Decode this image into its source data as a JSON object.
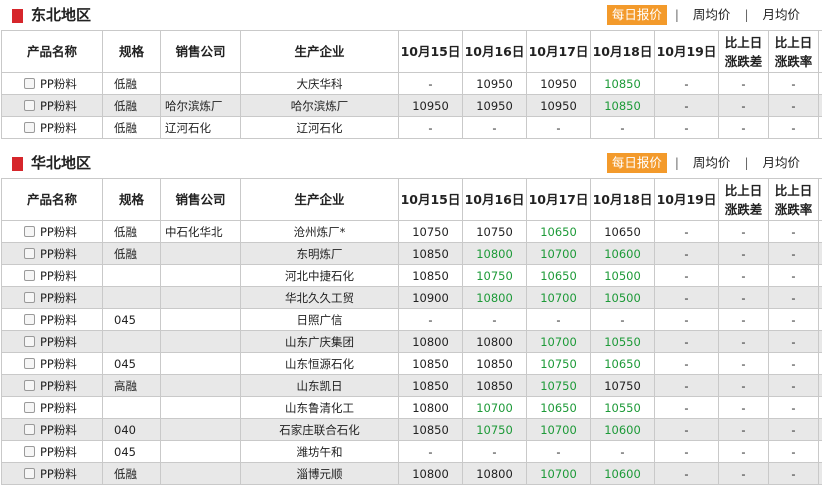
{
  "tabs": {
    "daily": "每日报价",
    "weekly": "周均价",
    "monthly": "月均价",
    "separator": "|"
  },
  "colors": {
    "accent": "#f39a2b",
    "marker": "#d6262b",
    "down": "#1d9a38",
    "row_alt": "#e8e8e8"
  },
  "columns": {
    "name": "产品名称",
    "spec": "规格",
    "sales": "销售公司",
    "producer": "生产企业",
    "d1": "10月15日",
    "d2": "10月16日",
    "d3": "10月17日",
    "d4": "10月18日",
    "d5": "10月19日",
    "diff_top": "比上日",
    "diff_bottom": "涨跌差",
    "rate_top": "比上日",
    "rate_bottom": "涨跌率"
  },
  "regions": [
    {
      "title": "东北地区",
      "rows": [
        {
          "name": "PP粉料",
          "spec": "低融",
          "sales": "",
          "producer": "大庆华科",
          "d1": "-",
          "d2": "10950",
          "d3": "10950",
          "d4": "10850",
          "d5": "-",
          "diff": "-",
          "rate": "-",
          "green": [
            "d4"
          ]
        },
        {
          "name": "PP粉料",
          "spec": "低融",
          "sales": "哈尔滨炼厂",
          "producer": "哈尔滨炼厂",
          "d1": "10950",
          "d2": "10950",
          "d3": "10950",
          "d4": "10850",
          "d5": "-",
          "diff": "-",
          "rate": "-",
          "green": [
            "d4"
          ]
        },
        {
          "name": "PP粉料",
          "spec": "低融",
          "sales": "辽河石化",
          "producer": "辽河石化",
          "d1": "-",
          "d2": "-",
          "d3": "-",
          "d4": "-",
          "d5": "-",
          "diff": "-",
          "rate": "-",
          "green": []
        }
      ]
    },
    {
      "title": "华北地区",
      "rows": [
        {
          "name": "PP粉料",
          "spec": "低融",
          "sales": "中石化华北",
          "producer": "沧州炼厂*",
          "d1": "10750",
          "d2": "10750",
          "d3": "10650",
          "d4": "10650",
          "d5": "-",
          "diff": "-",
          "rate": "-",
          "green": [
            "d3"
          ]
        },
        {
          "name": "PP粉料",
          "spec": "低融",
          "sales": "",
          "producer": "东明炼厂",
          "d1": "10850",
          "d2": "10800",
          "d3": "10700",
          "d4": "10600",
          "d5": "-",
          "diff": "-",
          "rate": "-",
          "green": [
            "d2",
            "d3",
            "d4"
          ]
        },
        {
          "name": "PP粉料",
          "spec": "",
          "sales": "",
          "producer": "河北中捷石化",
          "d1": "10850",
          "d2": "10750",
          "d3": "10650",
          "d4": "10500",
          "d5": "-",
          "diff": "-",
          "rate": "-",
          "green": [
            "d2",
            "d3",
            "d4"
          ]
        },
        {
          "name": "PP粉料",
          "spec": "",
          "sales": "",
          "producer": "华北久久工贸",
          "d1": "10900",
          "d2": "10800",
          "d3": "10700",
          "d4": "10500",
          "d5": "-",
          "diff": "-",
          "rate": "-",
          "green": [
            "d2",
            "d3",
            "d4"
          ]
        },
        {
          "name": "PP粉料",
          "spec": "045",
          "sales": "",
          "producer": "日照广信",
          "d1": "-",
          "d2": "-",
          "d3": "-",
          "d4": "-",
          "d5": "-",
          "diff": "-",
          "rate": "-",
          "green": []
        },
        {
          "name": "PP粉料",
          "spec": "",
          "sales": "",
          "producer": "山东广庆集团",
          "d1": "10800",
          "d2": "10800",
          "d3": "10700",
          "d4": "10550",
          "d5": "-",
          "diff": "-",
          "rate": "-",
          "green": [
            "d3",
            "d4"
          ]
        },
        {
          "name": "PP粉料",
          "spec": "045",
          "sales": "",
          "producer": "山东恒源石化",
          "d1": "10850",
          "d2": "10850",
          "d3": "10750",
          "d4": "10650",
          "d5": "-",
          "diff": "-",
          "rate": "-",
          "green": [
            "d3",
            "d4"
          ]
        },
        {
          "name": "PP粉料",
          "spec": "高融",
          "sales": "",
          "producer": "山东凯日",
          "d1": "10850",
          "d2": "10850",
          "d3": "10750",
          "d4": "10750",
          "d5": "-",
          "diff": "-",
          "rate": "-",
          "green": [
            "d3"
          ]
        },
        {
          "name": "PP粉料",
          "spec": "",
          "sales": "",
          "producer": "山东鲁清化工",
          "d1": "10800",
          "d2": "10700",
          "d3": "10650",
          "d4": "10550",
          "d5": "-",
          "diff": "-",
          "rate": "-",
          "green": [
            "d2",
            "d3",
            "d4"
          ]
        },
        {
          "name": "PP粉料",
          "spec": "040",
          "sales": "",
          "producer": "石家庄联合石化",
          "d1": "10850",
          "d2": "10750",
          "d3": "10700",
          "d4": "10600",
          "d5": "-",
          "diff": "-",
          "rate": "-",
          "green": [
            "d2",
            "d3",
            "d4"
          ]
        },
        {
          "name": "PP粉料",
          "spec": "045",
          "sales": "",
          "producer": "潍坊午和",
          "d1": "-",
          "d2": "-",
          "d3": "-",
          "d4": "-",
          "d5": "-",
          "diff": "-",
          "rate": "-",
          "green": []
        },
        {
          "name": "PP粉料",
          "spec": "低融",
          "sales": "",
          "producer": "淄博元顺",
          "d1": "10800",
          "d2": "10800",
          "d3": "10700",
          "d4": "10600",
          "d5": "-",
          "diff": "-",
          "rate": "-",
          "green": [
            "d3",
            "d4"
          ]
        }
      ]
    }
  ]
}
